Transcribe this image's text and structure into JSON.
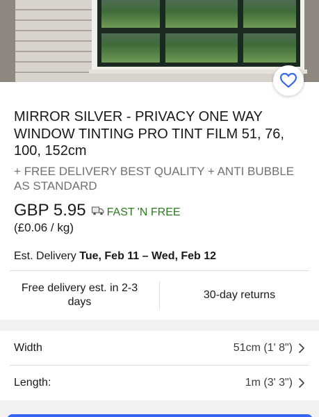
{
  "product": {
    "title": "MIRROR SILVER - PRIVACY ONE WAY WINDOW TINTING PRO TINT FILM 51, 76, 100, 152cm",
    "subtitle": "+ FREE DELIVERY BEST QUALITY + ANTI BUBBLE AS STANDARD",
    "price": "GBP 5.95",
    "shipping_tag": "FAST 'N FREE",
    "unit_price": "(£0.06 / kg)"
  },
  "delivery": {
    "label": "Est. Delivery ",
    "dates": "Tue, Feb 11 – Wed, Feb 12"
  },
  "benefits": {
    "free_delivery": "Free delivery est. in 2-3 days",
    "returns": "30-day returns"
  },
  "variations": [
    {
      "label": "Width",
      "value": "51cm (1' 8\")"
    },
    {
      "label": "Length:",
      "value": "1m (3' 3\")"
    }
  ],
  "icons": {
    "favorite": "heart-icon",
    "shipping": "truck-icon",
    "chevron": "chevron-right-icon"
  },
  "colors": {
    "accent": "#3665f3",
    "shipping_green": "#2b7a1f",
    "secondary_text": "#707070"
  }
}
